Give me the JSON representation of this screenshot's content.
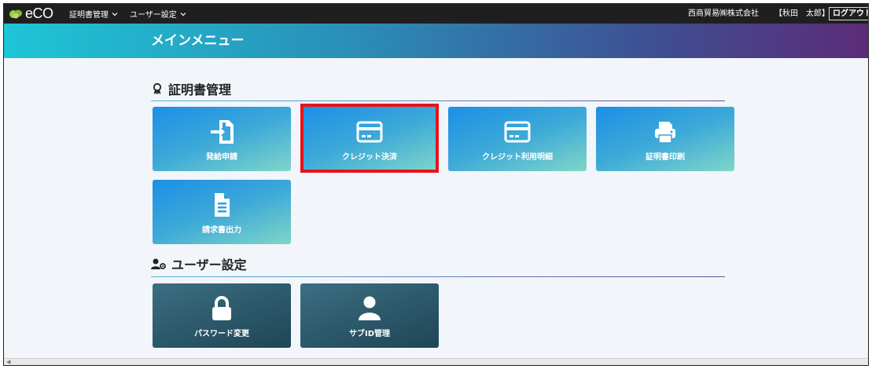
{
  "topbar": {
    "logo_text": "eCO",
    "menu": [
      {
        "label": "証明書管理"
      },
      {
        "label": "ユーザー設定"
      }
    ],
    "company": "西商貿易㈱株式会社",
    "user": "【秋田　太郎】",
    "logout_label": "ログアウト"
  },
  "title": "メインメニュー",
  "sections": [
    {
      "heading": "証明書管理",
      "icon": "award-icon",
      "tiles": [
        {
          "label": "発給申請",
          "icon": "sign-in-icon"
        },
        {
          "label": "クレジット決済",
          "icon": "credit-card-icon",
          "highlighted": true
        },
        {
          "label": "クレジット利用明細",
          "icon": "credit-card-icon"
        },
        {
          "label": "証明書印刷",
          "icon": "printer-icon"
        },
        {
          "label": "請求書出力",
          "icon": "document-icon"
        }
      ]
    },
    {
      "heading": "ユーザー設定",
      "icon": "user-gear-icon",
      "tiles": [
        {
          "label": "パスワード変更",
          "icon": "lock-icon"
        },
        {
          "label": "サブID管理",
          "icon": "user-icon"
        }
      ]
    }
  ],
  "colors": {
    "highlight": "#e8121a",
    "tile_blue": "#1c8fe6",
    "tile_dark": "#2c5a6c",
    "topbar": "#1f1f1f"
  }
}
